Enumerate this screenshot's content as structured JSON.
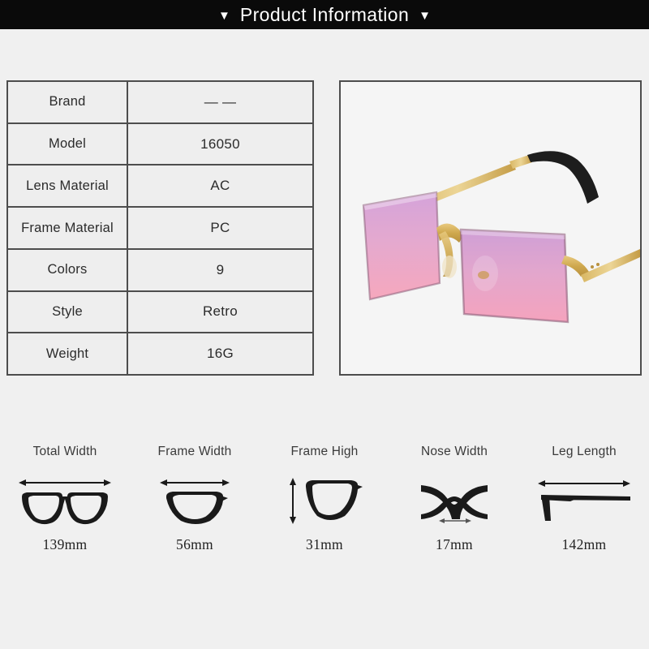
{
  "header": {
    "title": "Product Information",
    "left_triangle": "▼",
    "right_triangle": "▼",
    "background_color": "#0a0a0a",
    "text_color": "#ffffff"
  },
  "page": {
    "background_color": "#f0f0f0",
    "border_color": "#4d4d4d"
  },
  "spec_table": {
    "rows": [
      {
        "label": "Brand",
        "value": "— —"
      },
      {
        "label": "Model",
        "value": "16050"
      },
      {
        "label": "Lens Material",
        "value": "AC"
      },
      {
        "label": "Frame Material",
        "value": "PC"
      },
      {
        "label": "Colors",
        "value": "9"
      },
      {
        "label": "Style",
        "value": "Retro"
      },
      {
        "label": "Weight",
        "value": "16G"
      }
    ]
  },
  "product_photo": {
    "alt": "rimless rectangular sunglasses with purple to pink gradient lenses",
    "lens_top_color": "#cf9fd6",
    "lens_bottom_color": "#f4a4bd",
    "metal_color": "#d8b25f",
    "tip_color": "#1a1a1a",
    "background_color": "#f5f5f5"
  },
  "measurements": [
    {
      "label": "Total Width",
      "value": "139mm",
      "icon": "full-glasses-icon",
      "arrow": "horizontal"
    },
    {
      "label": "Frame Width",
      "value": "56mm",
      "icon": "single-lens-icon",
      "arrow": "horizontal"
    },
    {
      "label": "Frame High",
      "value": "31mm",
      "icon": "single-lens-icon",
      "arrow": "vertical"
    },
    {
      "label": "Nose Width",
      "value": "17mm",
      "icon": "nose-bridge-icon",
      "arrow": "horizontal-small"
    },
    {
      "label": "Leg Length",
      "value": "142mm",
      "icon": "temple-arm-icon",
      "arrow": "horizontal"
    }
  ]
}
